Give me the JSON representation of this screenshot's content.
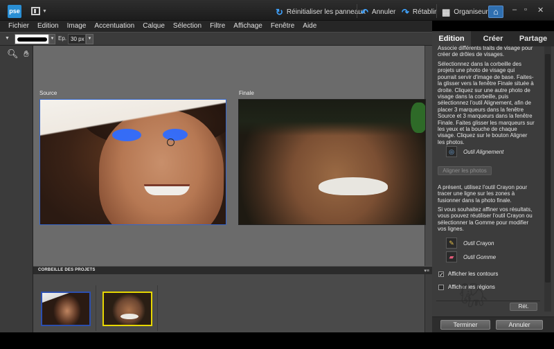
{
  "titlebar": {
    "logo": "pse",
    "reset_panels": "Réinitialiser les panneaux",
    "undo": "Annuler",
    "redo": "Rétablir",
    "organizer": "Organiseur",
    "minimize": "–",
    "maximize": "▫",
    "close": "✕"
  },
  "menu": [
    "Fichier",
    "Edition",
    "Image",
    "Accentuation",
    "Calque",
    "Sélection",
    "Filtre",
    "Affichage",
    "Fenêtre",
    "Aide"
  ],
  "options": {
    "size_label": "Ep. :",
    "size_value": "30 px"
  },
  "workspace": {
    "source_label": "Source",
    "final_label": "Finale"
  },
  "bin": {
    "title": "CORBEILLE DES PROJETS"
  },
  "panel": {
    "tabs": [
      "Edition",
      "Créer",
      "Partage"
    ],
    "intro": "Associe différents traits de visage pour créer de drôles de visages.",
    "instructions": "Sélectionnez dans la corbeille des projets une photo de visage qui pourrait servir d'image de base. Faites-la glisser vers la fenêtre Finale située à droite. Cliquez sur une autre photo de visage dans la corbeille, puis sélectionnez l'outil Alignement, afin de placer 3 marqueurs dans la fenêtre Source et 3 marqueurs dans la fenêtre Finale. Faites glisser les marqueurs sur les yeux et la bouche de chaque visage. Cliquez sur le bouton Aligner les photos.",
    "align_tool": "Outil Alignement",
    "align_button": "Aligner les photos",
    "pencil_instruction": "A présent, utilisez l'outil Crayon pour tracer une ligne sur les zones à fusionner dans la photo finale.",
    "refine_instruction": "Si vous souhaitez affiner vos résultats, vous pouvez réutiliser l'outil Crayon ou sélectionner la Gomme pour modifier vos lignes.",
    "pencil_tool": "Outil Crayon",
    "eraser_tool": "Outil Gomme",
    "show_contours": "Afficher les contours",
    "show_regions": "Afficher les régions",
    "reset": "Rét.",
    "finish": "Terminer",
    "cancel": "Annuler"
  },
  "colors": {
    "accent": "#2e6bff",
    "selected_thumb": "#e8d800"
  }
}
